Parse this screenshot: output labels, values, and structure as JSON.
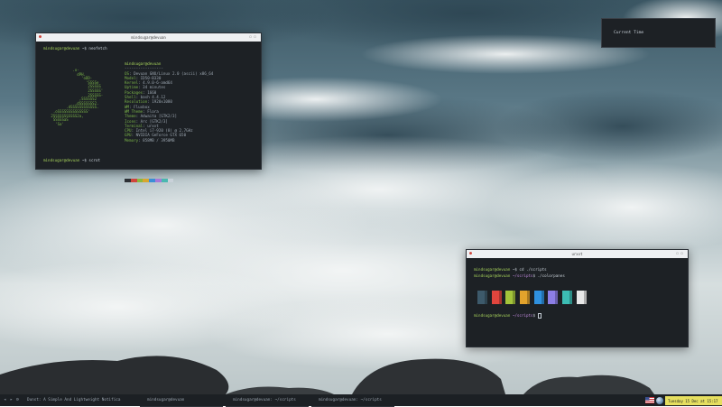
{
  "desktop": {
    "wallpaper_icon": "ocean-wave-wallpaper"
  },
  "neofetch_window": {
    "title": "mindsugar@devuan",
    "command_prompt": "mindsugar@devuan",
    "command": " ~$ neofetch",
    "user_host": "mindsugar@devuan",
    "separator": "-----------------",
    "info": [
      {
        "key": "OS",
        "value": ": Devuan GNU/Linux 2.0 (ascii) x86_64"
      },
      {
        "key": "Model",
        "value": ": ID50-B330"
      },
      {
        "key": "Kernel",
        "value": ": 4.9.0-6-amd64"
      },
      {
        "key": "Uptime",
        "value": ": 34 minutes"
      },
      {
        "key": "Packages",
        "value": ": 1660"
      },
      {
        "key": "Shell",
        "value": ": bash 4.4.12"
      },
      {
        "key": "Resolution",
        "value": ": 1920x1080"
      },
      {
        "key": "WM",
        "value": ": Fluxbox"
      },
      {
        "key": "WM Theme",
        "value": ": Flora"
      },
      {
        "key": "Theme",
        "value": ": Adwaita [GTK2/3]"
      },
      {
        "key": "Icons",
        "value": ": Arc [GTK2/3]"
      },
      {
        "key": "Terminal",
        "value": ": urxvt"
      },
      {
        "key": "CPU",
        "value": ": Intel i7-920 (8) @ 2.7GHz"
      },
      {
        "key": "GPU",
        "value": ": NVIDIA GeForce GTX 650"
      },
      {
        "key": "Memory",
        "value": ": 858MB / 3950MB"
      }
    ],
    "swatch_colors": [
      "#2d3035",
      "#d0463c",
      "#8bb83d",
      "#d7a62f",
      "#3b8ed6",
      "#a679d8",
      "#49b8b0",
      "#c9d1d9"
    ],
    "bottom_prompt": "mindsugar@devuan",
    "bottom_command": " ~$ scrot"
  },
  "colorpanes_window": {
    "title": "urxvt",
    "line1_prompt": "mindsugar@devuan",
    "line1_command": " ~$ cd ./scripts",
    "line2_prompt": "mindsugar@devuan",
    "line2_path": " ~/scripts",
    "line2_command": "$ ./colorpanes",
    "pane_colors": [
      "#3d5a6b",
      "#e0453d",
      "#a4c43a",
      "#e3a32c",
      "#2f91e0",
      "#8c7ee6",
      "#3cbdb4",
      "#e8e8e8"
    ],
    "line3_prompt": "mindsugar@devuan",
    "line3_path": " ~/scripts",
    "line3_command": "$ "
  },
  "clock_widget": {
    "label": "Current Time"
  },
  "taskbar": {
    "window_title": "Dunst: A Simple And Lightweight Notifica",
    "tasks": [
      {
        "label": "mindsugar@devuan"
      },
      {
        "label": "mindsugar@devuan: ~/scripts"
      },
      {
        "label": "mindsugar@devuan: ~/scripts"
      }
    ],
    "clock_text": "Tuesday 15 Dec at 15:17",
    "icons": [
      "back-icon",
      "forward-icon",
      "settings-icon"
    ]
  }
}
